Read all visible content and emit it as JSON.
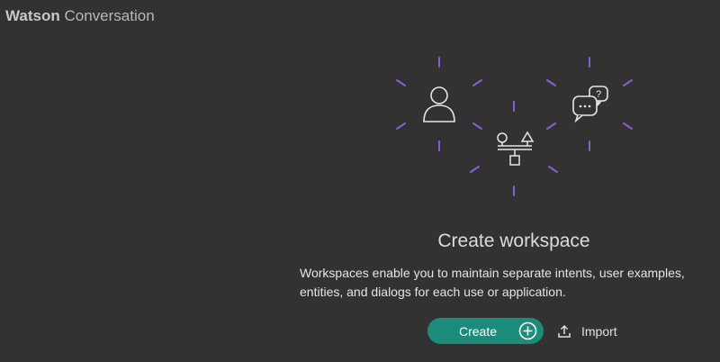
{
  "brand": {
    "name_bold": "Watson",
    "name_regular": " Conversation"
  },
  "colors": {
    "background": "#323232",
    "accent_purple": "#8a5cd6",
    "primary_button": "#1a8c79",
    "icon_stroke": "#e6e6e6"
  },
  "illustration": {
    "icons": [
      "person-icon",
      "entity-shapes-icon",
      "chat-bubbles-icon"
    ]
  },
  "empty_state": {
    "title": "Create workspace",
    "description": "Workspaces enable you to maintain separate intents, user examples, entities, and dialogs for each use or application."
  },
  "actions": {
    "create_label": "Create",
    "create_icon": "plus-circle-icon",
    "import_label": "Import",
    "import_icon": "upload-icon"
  }
}
